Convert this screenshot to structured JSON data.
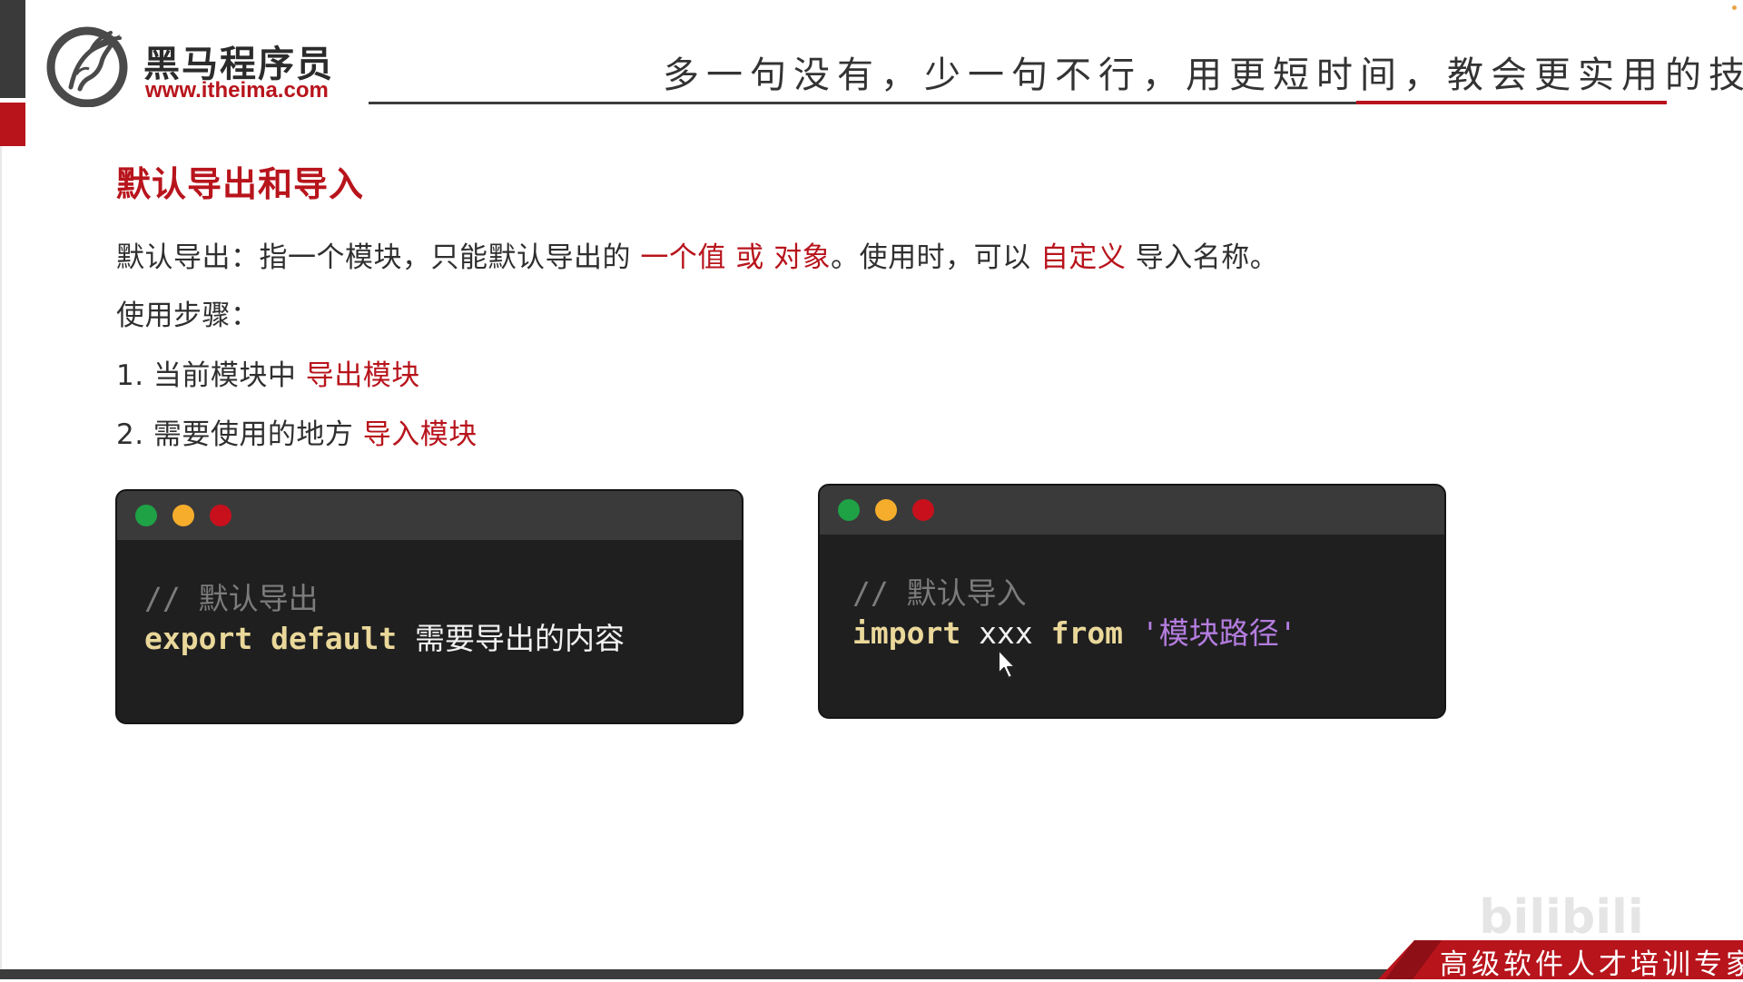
{
  "header": {
    "logo_cn": "黑马程序员",
    "logo_url": "www.itheima.com",
    "slogan": "多一句没有，少一句不行，用更短时间，教会更实用的技术!"
  },
  "slide": {
    "title": "默认导出和导入",
    "line1": {
      "prefix": "默认导出：指一个模块，只能默认导出的 ",
      "hl1": "一个值 或 对象",
      "mid": "。使用时，可以 ",
      "hl2": "自定义",
      "suffix": " 导入名称。"
    },
    "line2": "使用步骤：",
    "line3": {
      "prefix": "1. 当前模块中 ",
      "hl": "导出模块"
    },
    "line4": {
      "prefix": "2. 需要使用的地方 ",
      "hl": "导入模块"
    }
  },
  "code_export": {
    "comment": "// 默认导出",
    "kw1": "export",
    "kw2": "default",
    "rest": "需要导出的内容"
  },
  "code_import": {
    "comment": "// 默认导入",
    "kw1": "import",
    "ident": "xxx",
    "kw2": "from",
    "string": "'模块路径'"
  },
  "footer": {
    "tagline": "高级软件人才培训专家",
    "watermark": "bilibili"
  },
  "colors": {
    "accent_red": "#b8141c",
    "code_bg": "#1f1f20",
    "keyword": "#ead89a",
    "string": "#b47ddf",
    "comment": "#7c7c7c"
  },
  "icons": [
    "logo-horse-icon",
    "window-close-dot-icon",
    "window-minimize-dot-icon",
    "window-maximize-dot-icon",
    "mouse-cursor-icon"
  ]
}
